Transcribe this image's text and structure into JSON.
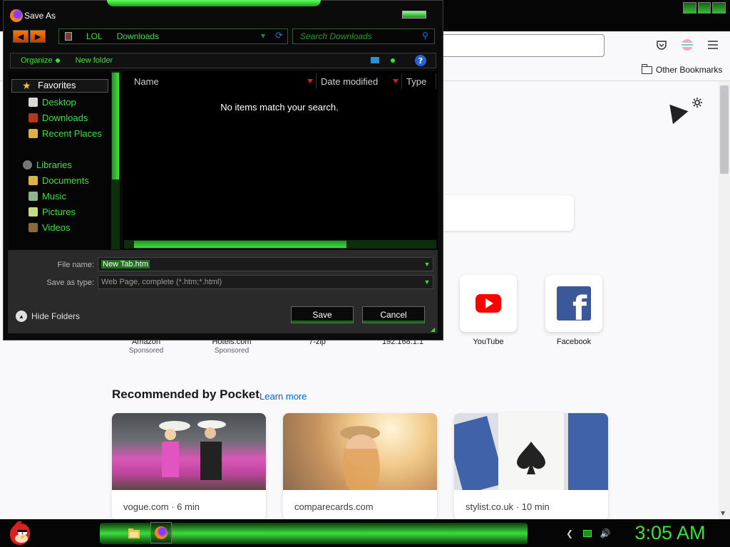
{
  "browser": {
    "bookmark_label": "Other Bookmarks",
    "pocket_title": "Recommended by Pocket",
    "pocket_link": "Learn more",
    "shortcuts": [
      {
        "label": "Amazon",
        "sub": "Sponsored"
      },
      {
        "label": "Hotels.com",
        "sub": "Sponsored"
      },
      {
        "label": "7-zip",
        "sub": ""
      },
      {
        "label": "192.168.1.1",
        "sub": ""
      },
      {
        "label": "YouTube",
        "sub": ""
      },
      {
        "label": "Facebook",
        "sub": ""
      }
    ],
    "cards": [
      {
        "source": "vogue.com · 6 min"
      },
      {
        "source": "comparecards.com"
      },
      {
        "source": "stylist.co.uk · 10 min"
      }
    ]
  },
  "dialog": {
    "title": "Save As",
    "breadcrumb": [
      "LOL",
      "Downloads"
    ],
    "search_placeholder": "Search Downloads",
    "organize": "Organize",
    "new_folder": "New folder",
    "favorites": "Favorites",
    "favorite_items": [
      "Desktop",
      "Downloads",
      "Recent Places"
    ],
    "libraries": "Libraries",
    "library_items": [
      "Documents",
      "Music",
      "Pictures",
      "Videos"
    ],
    "columns": [
      "Name",
      "Date modified",
      "Type"
    ],
    "empty_message": "No items match your search.",
    "file_name_label": "File name:",
    "file_name_value": "New Tab.htm",
    "save_type_label": "Save as type:",
    "save_type_value": "Web Page, complete (*.htm;*.html)",
    "hide_folders": "Hide Folders",
    "save_button": "Save",
    "cancel_button": "Cancel"
  },
  "taskbar": {
    "clock": "3:05 AM"
  },
  "colors": {
    "accent_green": "#38e238",
    "dialog_bg": "#0b0b0b",
    "youtube_red": "#ff0000",
    "facebook_blue": "#3b5998",
    "link_blue": "#0061e0"
  }
}
